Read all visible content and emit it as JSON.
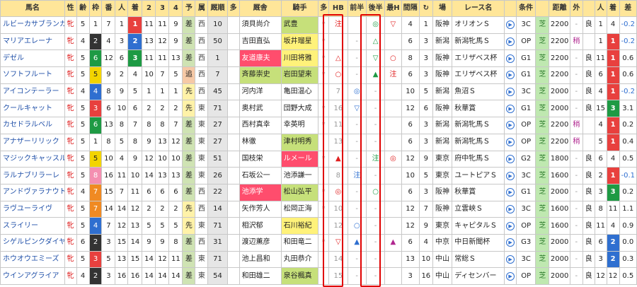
{
  "headers": [
    "馬名",
    "性",
    "齢",
    "枠",
    "番",
    "人",
    "着",
    "2",
    "3",
    "4",
    "予",
    "属",
    "厩順",
    "多",
    "厩舎",
    "騎手",
    "多",
    "HB",
    "前半",
    "後半",
    "最H",
    "間隔",
    "↻",
    "場",
    "レース名",
    "",
    "条件",
    "",
    "距離",
    "外",
    "",
    "人",
    "着",
    "差"
  ],
  "rows": [
    {
      "name": "ルビーカサブランカ",
      "sex": "牝",
      "age": "5",
      "waku": "1",
      "ban": "7",
      "pop": "1",
      "rank": "1",
      "c2": "11",
      "c3": "11",
      "c4": "9",
      "yosou": "差",
      "zoku": "西",
      "kyu": "10",
      "ta": "",
      "trainer": "須貝尚介",
      "jockey": "武豊",
      "ta2": "*",
      "hb": "注",
      "zen": "",
      "kou": "◎",
      "saih": "▽",
      "kankaku": "4",
      "loop": "1",
      "ba": "阪神",
      "race": "オリオンＳ",
      "cond": "3C",
      "dist": "2200",
      "gai": "-",
      "baba": "良",
      "lp": "1",
      "lr": "4",
      "diff": "-0.2"
    },
    {
      "name": "マリアエレーナ",
      "sex": "牝",
      "age": "4",
      "waku": "2",
      "ban": "4",
      "pop": "3",
      "rank": "2",
      "c2": "13",
      "c3": "12",
      "c4": "9",
      "yosou": "差",
      "zoku": "西",
      "kyu": "50",
      "ta": "",
      "trainer": "吉田直弘",
      "jockey": "坂井瑠星",
      "ta2": "*",
      "hb": "",
      "zen": "-",
      "kou": "△",
      "saih": "",
      "kankaku": "6",
      "loop": "3",
      "ba": "新潟",
      "race": "新潟牝馬Ｓ",
      "cond": "OP",
      "dist": "2200",
      "gai": "稍",
      "baba": "",
      "lp": "1",
      "lr": "1",
      "diff": "-0.2"
    },
    {
      "name": "デゼル",
      "sex": "牝",
      "age": "5",
      "waku": "6",
      "ban": "12",
      "pop": "6",
      "rank": "3",
      "c2": "11",
      "c3": "11",
      "c4": "13",
      "yosou": "差",
      "zoku": "西",
      "kyu": "1",
      "ta": "",
      "trainer": "友道康夫",
      "jockey": "川田将雅",
      "ta2": "*",
      "hb": "△",
      "zen": "-",
      "kou": "▽",
      "saih": "○",
      "kankaku": "8",
      "loop": "3",
      "ba": "阪神",
      "race": "エリザベス杯",
      "cond": "G1",
      "dist": "2200",
      "gai": "-",
      "baba": "良",
      "lp": "11",
      "lr": "1",
      "diff": "0.6"
    },
    {
      "name": "ソフトフルート",
      "sex": "牝",
      "age": "5",
      "waku": "5",
      "ban": "9",
      "pop": "2",
      "rank": "4",
      "c2": "10",
      "c3": "7",
      "c4": "5",
      "yosou": "追",
      "zoku": "西",
      "kyu": "7",
      "ta": "",
      "trainer": "斉藤崇史",
      "jockey": "岩田望来",
      "ta2": "*",
      "hb": "○",
      "zen": "-",
      "kou": "▲",
      "saih": "注",
      "kankaku": "6",
      "loop": "3",
      "ba": "阪神",
      "race": "エリザベス杯",
      "cond": "G1",
      "dist": "2200",
      "gai": "-",
      "baba": "良",
      "lp": "6",
      "lr": "1",
      "diff": "0.6"
    },
    {
      "name": "アイコンテーラー",
      "sex": "牝",
      "age": "4",
      "waku": "4",
      "ban": "8",
      "pop": "9",
      "rank": "5",
      "c2": "1",
      "c3": "1",
      "c4": "1",
      "yosou": "先",
      "zoku": "西",
      "kyu": "45",
      "ta": "",
      "trainer": "河内洋",
      "jockey": "亀田温心",
      "ta2": "",
      "hb": "7",
      "zen": "◎",
      "kou": "-",
      "saih": "",
      "kankaku": "10",
      "loop": "5",
      "ba": "新潟",
      "race": "魚沼Ｓ",
      "cond": "3C",
      "dist": "2000",
      "gai": "-",
      "baba": "良",
      "lp": "4",
      "lr": "1",
      "diff": "-0.2"
    },
    {
      "name": "クールキャット",
      "sex": "牝",
      "age": "5",
      "waku": "3",
      "ban": "6",
      "pop": "10",
      "rank": "6",
      "c2": "2",
      "c3": "2",
      "c4": "2",
      "yosou": "先",
      "zoku": "東",
      "kyu": "71",
      "ta": "",
      "trainer": "奥村武",
      "jockey": "団野大成",
      "ta2": "*",
      "hb": "16",
      "zen": "▽",
      "kou": "-",
      "saih": "",
      "kankaku": "12",
      "loop": "6",
      "ba": "阪神",
      "race": "秋華賞",
      "cond": "G1",
      "dist": "2000",
      "gai": "-",
      "baba": "良",
      "lp": "15",
      "lr": "3",
      "diff": "3.1"
    },
    {
      "name": "カセドラルベル",
      "sex": "牝",
      "age": "5",
      "waku": "6",
      "ban": "13",
      "pop": "8",
      "rank": "7",
      "c2": "8",
      "c3": "8",
      "c4": "7",
      "yosou": "差",
      "zoku": "東",
      "kyu": "27",
      "ta": "",
      "trainer": "西村真幸",
      "jockey": "幸英明",
      "ta2": "*",
      "hb": "11",
      "zen": "-",
      "kou": "-",
      "saih": "",
      "kankaku": "6",
      "loop": "3",
      "ba": "新潟",
      "race": "新潟牝馬Ｓ",
      "cond": "OP",
      "dist": "2200",
      "gai": "稍",
      "baba": "",
      "lp": "4",
      "lr": "1",
      "diff": "0.2"
    },
    {
      "name": "アナザーリリック",
      "sex": "牝",
      "age": "5",
      "waku": "1",
      "ban": "8",
      "pop": "5",
      "rank": "8",
      "c2": "9",
      "c3": "13",
      "c4": "12",
      "yosou": "差",
      "zoku": "東",
      "kyu": "27",
      "ta": "",
      "trainer": "林徹",
      "jockey": "津村明秀",
      "ta2": "",
      "hb": "13",
      "zen": "-",
      "kou": "-",
      "saih": "",
      "kankaku": "6",
      "loop": "3",
      "ba": "新潟",
      "race": "新潟牝馬Ｓ",
      "cond": "OP",
      "dist": "2200",
      "gai": "稍",
      "baba": "",
      "lp": "5",
      "lr": "1",
      "diff": "0.4"
    },
    {
      "name": "マジックキャッスル",
      "sex": "牝",
      "age": "5",
      "waku": "5",
      "ban": "10",
      "pop": "4",
      "rank": "9",
      "c2": "12",
      "c3": "10",
      "c4": "10",
      "yosou": "差",
      "zoku": "東",
      "kyu": "51",
      "ta": "",
      "trainer": "国枝栄",
      "jockey": "ルメール",
      "ta2": "*",
      "hb": "▲",
      "zen": "-",
      "kou": "注",
      "saih": "◎",
      "kankaku": "12",
      "loop": "9",
      "ba": "東京",
      "race": "府中牝馬Ｓ",
      "cond": "G2",
      "dist": "1800",
      "gai": "-",
      "baba": "良",
      "lp": "6",
      "lr": "4",
      "diff": "0.5"
    },
    {
      "name": "ラルナブリラーレ",
      "sex": "牝",
      "age": "5",
      "waku": "8",
      "ban": "16",
      "pop": "11",
      "rank": "10",
      "c2": "14",
      "c3": "13",
      "c4": "13",
      "yosou": "差",
      "zoku": "東",
      "kyu": "26",
      "ta": "",
      "trainer": "石坂公一",
      "jockey": "池添謙一",
      "ta2": "",
      "hb": "8",
      "zen": "注",
      "kou": "-",
      "saih": "",
      "kankaku": "10",
      "loop": "5",
      "ba": "東京",
      "race": "ユートピアＳ",
      "cond": "3C",
      "dist": "1600",
      "gai": "-",
      "baba": "良",
      "lp": "2",
      "lr": "1",
      "diff": "-0.1"
    },
    {
      "name": "アンドヴァラナウト",
      "sex": "牝",
      "age": "4",
      "waku": "7",
      "ban": "15",
      "pop": "7",
      "rank": "11",
      "c2": "6",
      "c3": "6",
      "c4": "6",
      "yosou": "差",
      "zoku": "西",
      "kyu": "22",
      "ta": "",
      "trainer": "池添学",
      "jockey": "松山弘平",
      "ta2": "*",
      "hb": "◎",
      "zen": "-",
      "kou": "○",
      "saih": "",
      "kankaku": "6",
      "loop": "3",
      "ba": "阪神",
      "race": "秋華賞",
      "cond": "G1",
      "dist": "2000",
      "gai": "-",
      "baba": "良",
      "lp": "3",
      "lr": "3",
      "diff": "0.2"
    },
    {
      "name": "ラヴユーライヴ",
      "sex": "牝",
      "age": "5",
      "waku": "7",
      "ban": "14",
      "pop": "14",
      "rank": "12",
      "c2": "2",
      "c3": "2",
      "c4": "2",
      "yosou": "先",
      "zoku": "西",
      "kyu": "14",
      "ta": "",
      "trainer": "矢作芳人",
      "jockey": "松岡正海",
      "ta2": "*",
      "hb": "10",
      "zen": "-",
      "kou": "-",
      "saih": "",
      "kankaku": "12",
      "loop": "7",
      "ba": "阪神",
      "race": "立雲峡Ｓ",
      "cond": "3C",
      "dist": "1600",
      "gai": "-",
      "baba": "良",
      "lp": "8",
      "lr": "11",
      "diff": "1.1"
    },
    {
      "name": "スライリー",
      "sex": "牝",
      "age": "5",
      "waku": "4",
      "ban": "7",
      "pop": "12",
      "rank": "13",
      "c2": "5",
      "c3": "5",
      "c4": "5",
      "yosou": "先",
      "zoku": "東",
      "kyu": "71",
      "ta": "",
      "trainer": "相沢郁",
      "jockey": "石川裕紀",
      "ta2": "",
      "hb": "12",
      "zen": "○",
      "kou": "-",
      "saih": "",
      "kankaku": "12",
      "loop": "9",
      "ba": "東京",
      "race": "キャピタルＳ",
      "cond": "OP",
      "dist": "1600",
      "gai": "-",
      "baba": "良",
      "lp": "11",
      "lr": "4",
      "diff": "0.9"
    },
    {
      "name": "シゲルピンクダイヤ",
      "sex": "牝",
      "age": "6",
      "waku": "2",
      "ban": "3",
      "pop": "15",
      "rank": "14",
      "c2": "9",
      "c3": "9",
      "c4": "8",
      "yosou": "差",
      "zoku": "西",
      "kyu": "31",
      "ta": "",
      "trainer": "渡辺薫彦",
      "jockey": "和田竜二",
      "ta2": "*",
      "hb": "▽",
      "zen": "▲",
      "kou": "-",
      "saih": "▲",
      "kankaku": "6",
      "loop": "4",
      "ba": "中京",
      "race": "中日新聞杯",
      "cond": "G3",
      "dist": "2000",
      "gai": "-",
      "baba": "良",
      "lp": "6",
      "lr": "2",
      "diff": "0.0"
    },
    {
      "name": "ホウオウエミーズ",
      "sex": "牝",
      "age": "5",
      "waku": "3",
      "ban": "5",
      "pop": "13",
      "rank": "15",
      "c2": "14",
      "c3": "12",
      "c4": "11",
      "yosou": "差",
      "zoku": "東",
      "kyu": "71",
      "ta": "",
      "trainer": "池上昌和",
      "jockey": "丸田恭介",
      "ta2": "",
      "hb": "14",
      "zen": "-",
      "kou": "-",
      "saih": "",
      "kankaku": "13",
      "loop": "10",
      "ba": "中山",
      "race": "常総Ｓ",
      "cond": "3C",
      "dist": "2000",
      "gai": "-",
      "baba": "良",
      "lp": "3",
      "lr": "2",
      "diff": "0.3"
    },
    {
      "name": "ウインアグライア",
      "sex": "牝",
      "age": "4",
      "waku": "2",
      "ban": "3",
      "pop": "16",
      "rank": "16",
      "c2": "14",
      "c3": "14",
      "c4": "14",
      "yosou": "差",
      "zoku": "東",
      "kyu": "54",
      "ta": "",
      "trainer": "和田雄二",
      "jockey": "泉谷楓真",
      "ta2": "",
      "hb": "15",
      "zen": "-",
      "kou": "-",
      "saih": "",
      "kankaku": "3",
      "loop": "16",
      "ba": "中山",
      "race": "ディセンバー",
      "cond": "OP",
      "dist": "2000",
      "gai": "-",
      "baba": "良",
      "lp": "12",
      "lr": "12",
      "diff": "0.5"
    }
  ]
}
